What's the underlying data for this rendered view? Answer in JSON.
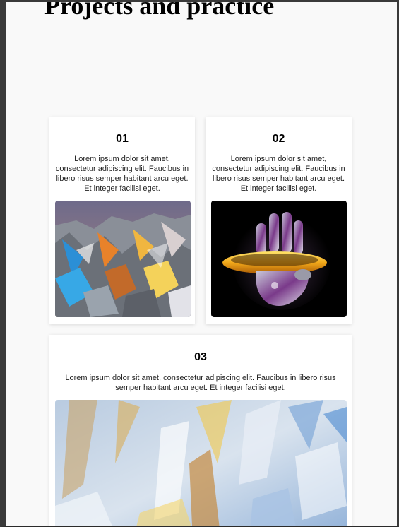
{
  "page": {
    "title": "Projects and practice"
  },
  "cards": [
    {
      "number": "01",
      "text": "Lorem ipsum dolor sit amet, consectetur adipiscing elit. Faucibus in libero risus semper habitant arcu eget. Et integer facilisi eget.",
      "image_icon": "crumpled-holographic-foil-image"
    },
    {
      "number": "02",
      "text": "Lorem ipsum dolor sit amet, consectetur adipiscing elit. Faucibus in libero risus semper habitant arcu eget. Et integer facilisi eget.",
      "image_icon": "chrome-hand-with-gold-ring-image"
    },
    {
      "number": "03",
      "text": "Lorem ipsum dolor sit amet, consectetur adipiscing elit. Faucibus in libero risus semper habitant arcu eget. Et integer facilisi eget.",
      "image_icon": "blurred-crystal-prism-image"
    }
  ],
  "colors": {
    "page_background": "#f9f9f9",
    "card_background": "#ffffff",
    "heading": "#000000"
  }
}
